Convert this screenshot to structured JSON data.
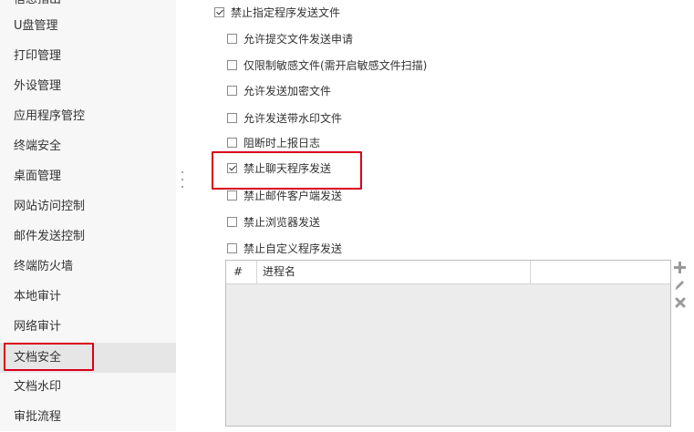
{
  "sidebar": {
    "items": [
      {
        "label": "信息指出",
        "cut": true
      },
      {
        "label": "U盘管理"
      },
      {
        "label": "打印管理"
      },
      {
        "label": "外设管理"
      },
      {
        "label": "应用程序管控"
      },
      {
        "label": "终端安全"
      },
      {
        "label": "桌面管理"
      },
      {
        "label": "网站访问控制"
      },
      {
        "label": "邮件发送控制"
      },
      {
        "label": "终端防火墙"
      },
      {
        "label": "本地审计"
      },
      {
        "label": "网络审计"
      },
      {
        "label": "文档安全",
        "active": true
      },
      {
        "label": "文档水印"
      },
      {
        "label": "审批流程"
      }
    ]
  },
  "options": {
    "block_program_send": {
      "label": "禁止指定程序发送文件",
      "checked": true
    },
    "allow_submit_request": {
      "label": "允许提交文件发送申请",
      "checked": false
    },
    "limit_sensitive": {
      "label": "仅限制敏感文件(需开启敏感文件扫描)",
      "checked": false
    },
    "allow_encrypted": {
      "label": "允许发送加密文件",
      "checked": false
    },
    "allow_watermark": {
      "label": "允许发送带水印文件",
      "checked": false
    },
    "log_on_block": {
      "label": "阻断时上报日志",
      "checked": false
    },
    "block_chat": {
      "label": "禁止聊天程序发送",
      "checked": true
    },
    "block_mail_client": {
      "label": "禁止邮件客户端发送",
      "checked": false
    },
    "block_browser": {
      "label": "禁止浏览器发送",
      "checked": false
    },
    "block_custom": {
      "label": "禁止自定义程序发送",
      "checked": false
    }
  },
  "process_table": {
    "columns": [
      "#",
      "进程名",
      ""
    ],
    "rows": []
  },
  "toolbar": {
    "add_icon": "plus-icon",
    "edit_icon": "pencil-icon",
    "delete_icon": "x-icon"
  },
  "colors": {
    "highlight_box": "#d9001b",
    "sidebar_bg": "#f7f7f7",
    "sidebar_active_bg": "#e6e6e6"
  }
}
